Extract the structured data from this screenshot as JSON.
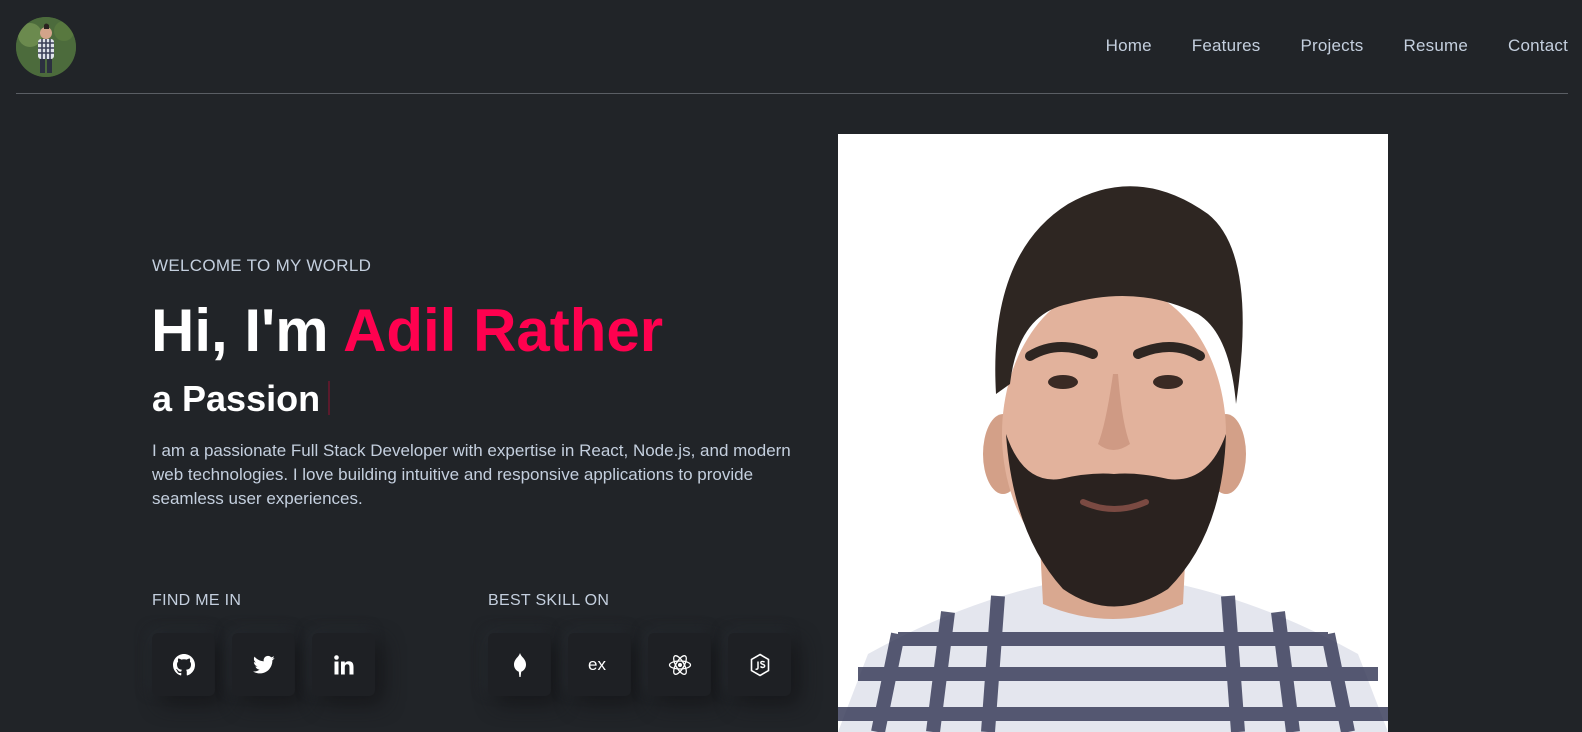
{
  "header": {
    "nav": [
      "Home",
      "Features",
      "Projects",
      "Resume",
      "Contact"
    ]
  },
  "hero": {
    "welcome": "WELCOME TO MY WORLD",
    "greeting": "Hi, I'm ",
    "name": "Adil Rather",
    "typed": "a Passion",
    "description": "I am a passionate Full Stack Developer with expertise in React, Node.js, and modern web technologies. I love building intuitive and responsive applications to provide seamless user experiences."
  },
  "find_me": {
    "title": "FIND ME IN",
    "icons": [
      "github-icon",
      "twitter-icon",
      "linkedin-icon"
    ]
  },
  "skills": {
    "title": "BEST SKILL ON",
    "icons": [
      "mongodb-icon",
      "express-icon",
      "react-icon",
      "nodejs-icon"
    ]
  },
  "colors": {
    "background": "#212428",
    "accent": "#ff014f",
    "text": "#c4cfde"
  }
}
